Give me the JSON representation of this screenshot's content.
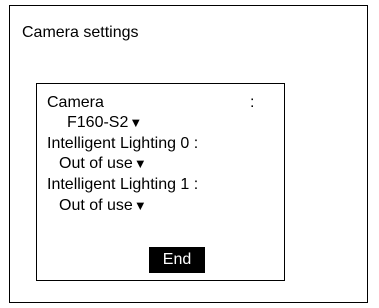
{
  "window": {
    "title": "Camera settings"
  },
  "settings": {
    "camera": {
      "label": "Camera",
      "colon": ":",
      "value": "F160-S2",
      "arrow": "▼"
    },
    "lighting0": {
      "label": "Intelligent Lighting 0 :",
      "value": "Out of use",
      "arrow": "▼"
    },
    "lighting1": {
      "label": "Intelligent Lighting 1 :",
      "value": "Out of use",
      "arrow": "▼"
    }
  },
  "buttons": {
    "end_label": "End"
  }
}
